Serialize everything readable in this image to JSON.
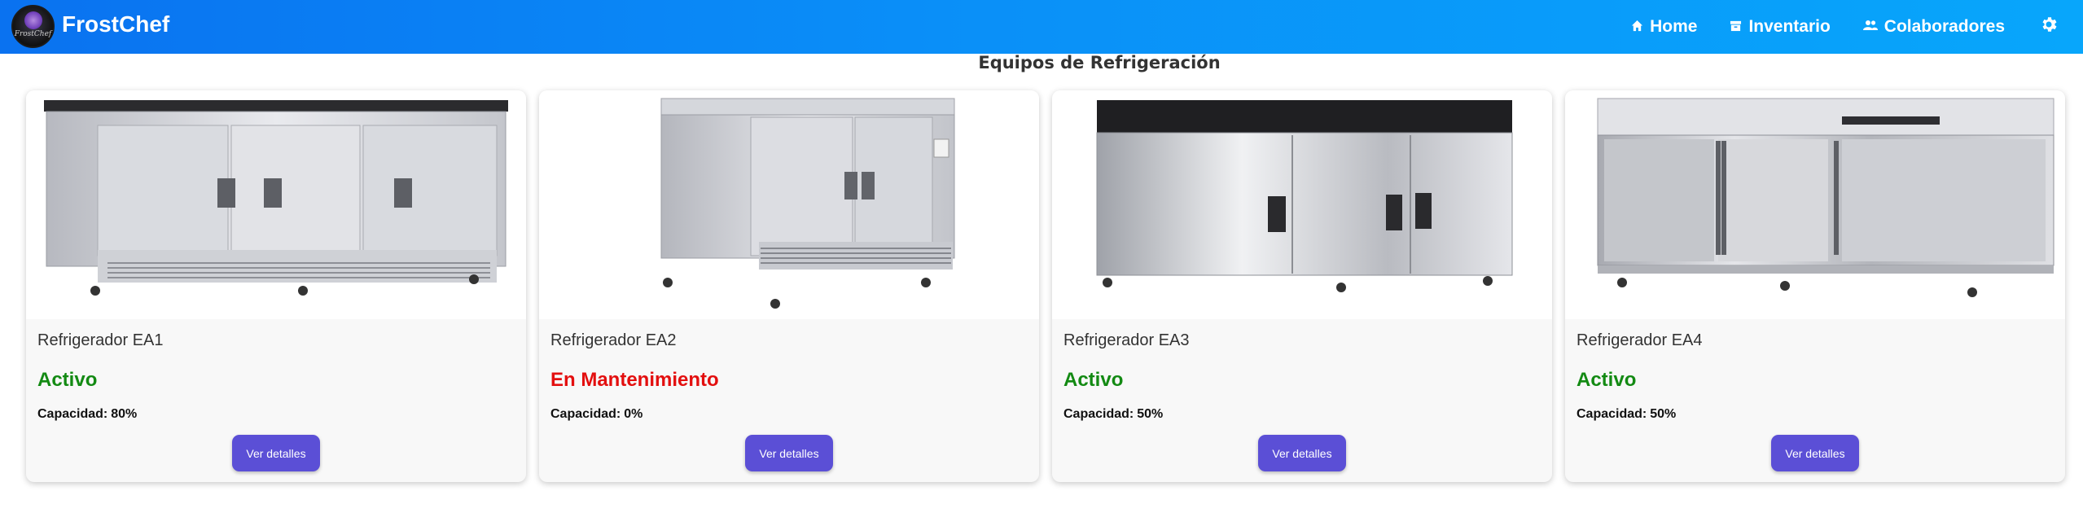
{
  "app": {
    "brand": "FrostChef",
    "logo_text": "FrostChef"
  },
  "nav": {
    "items": [
      {
        "label": "Home",
        "icon": "home-icon"
      },
      {
        "label": "Inventario",
        "icon": "archive-icon"
      },
      {
        "label": "Colaboradores",
        "icon": "users-icon"
      }
    ],
    "settings_icon": "gear-icon"
  },
  "section_title": "Equipos de Refrigeración",
  "cards": [
    {
      "name": "Refrigerador EA1",
      "status": "Activo",
      "status_type": "active",
      "capacity_label": "Capacidad:",
      "capacity": "80%",
      "button": "Ver detalles"
    },
    {
      "name": "Refrigerador EA2",
      "status": "En Mantenimiento",
      "status_type": "maintenance",
      "capacity_label": "Capacidad:",
      "capacity": "0%",
      "button": "Ver detalles"
    },
    {
      "name": "Refrigerador EA3",
      "status": "Activo",
      "status_type": "active",
      "capacity_label": "Capacidad:",
      "capacity": "50%",
      "button": "Ver detalles"
    },
    {
      "name": "Refrigerador EA4",
      "status": "Activo",
      "status_type": "active",
      "capacity_label": "Capacidad:",
      "capacity": "50%",
      "button": "Ver detalles"
    }
  ],
  "colors": {
    "nav_start": "#0a72f0",
    "nav_end": "#08a6fb",
    "active": "#138a13",
    "maintenance": "#e30f0f",
    "button": "#5b4fd6"
  }
}
